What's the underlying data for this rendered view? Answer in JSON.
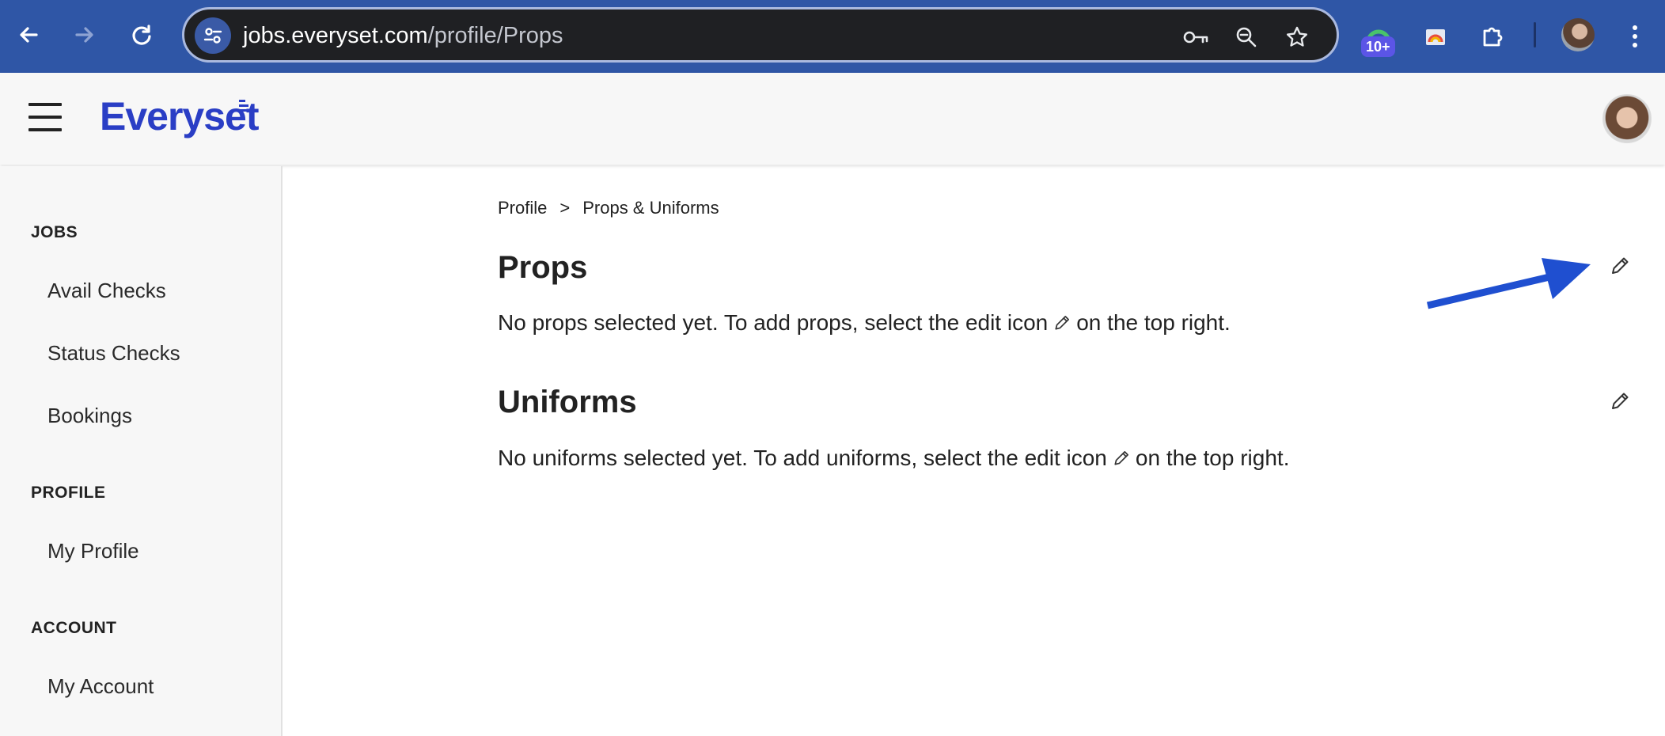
{
  "browser": {
    "url_host": "jobs.everyset.com",
    "url_path": "/profile/Props",
    "extension_badge": "10+"
  },
  "app": {
    "logo": "Everyset"
  },
  "sidebar": {
    "sections": [
      {
        "heading": "JOBS",
        "items": [
          "Avail Checks",
          "Status Checks",
          "Bookings"
        ]
      },
      {
        "heading": "PROFILE",
        "items": [
          "My Profile"
        ]
      },
      {
        "heading": "ACCOUNT",
        "items": [
          "My Account"
        ]
      }
    ]
  },
  "breadcrumb": {
    "root": "Profile",
    "separator": ">",
    "current": "Props & Uniforms"
  },
  "props": {
    "title": "Props",
    "text_before": "No props selected yet. To add props, select the edit icon",
    "text_after": "on the top right."
  },
  "uniforms": {
    "title": "Uniforms",
    "text_before": "No uniforms selected yet. To add uniforms, select the edit icon",
    "text_after": "on the top right."
  },
  "colors": {
    "chrome": "#2f56a6",
    "brand": "#2a3ec5",
    "annotation_arrow": "#1f4fd0"
  },
  "icons": [
    "back-icon",
    "forward-icon",
    "reload-icon",
    "site-settings-icon",
    "key-icon",
    "zoom-icon",
    "star-icon",
    "extensions-icon",
    "menu-icon",
    "hamburger-icon",
    "pencil-icon"
  ]
}
